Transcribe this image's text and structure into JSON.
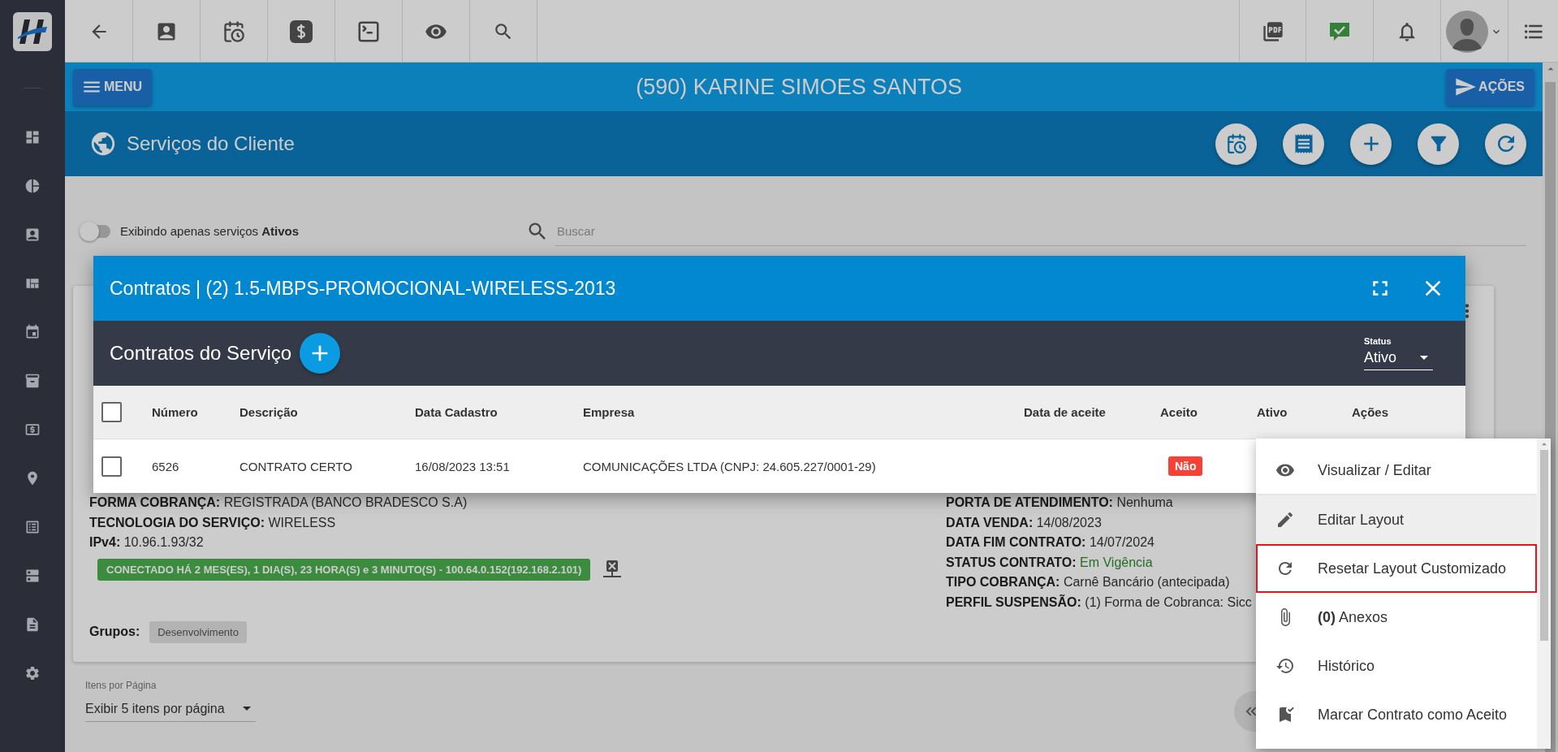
{
  "header": {
    "menu_button": "MENU",
    "client_title": "(590) KARINE SIMOES SANTOS",
    "actions_button": "AÇÕES"
  },
  "section": {
    "title": "Serviços do Cliente"
  },
  "filter": {
    "toggle_label": "Exibindo apenas serviços **Ativos**",
    "toggle_on": false,
    "search_placeholder": "Buscar"
  },
  "service_card": {
    "left_fields": [
      {
        "label": "FORMA COBRANÇA:",
        "value": "REGISTRADA (BANCO BRADESCO S.A)"
      },
      {
        "label": "TECNOLOGIA DO SERVIÇO:",
        "value": "WIRELESS"
      },
      {
        "label": "IPv4:",
        "value": "10.96.1.93/32"
      }
    ],
    "connection": "CONECTADO HÁ 2 MES(ES), 1 DIA(S), 23 HORA(S) e 3 MINUTO(S) - 100.64.0.152(192.168.2.101)",
    "groups_label": "Grupos:",
    "groups": [
      "Desenvolvimento"
    ],
    "right_fields": [
      {
        "label": "PORTA DE ATENDIMENTO:",
        "value": "Nenhuma",
        "kind": "plain"
      },
      {
        "label": "DATA VENDA:",
        "value": "14/08/2023",
        "kind": "plain"
      },
      {
        "label": "DATA FIM CONTRATO:",
        "value": "14/07/2024",
        "kind": "plain"
      },
      {
        "label": "STATUS CONTRATO:",
        "value": "Em Vigência",
        "kind": "status"
      },
      {
        "label": "TIPO COBRANÇA:",
        "value": "Carnê Bancário (antecipada)",
        "kind": "plain"
      },
      {
        "label": "PERFIL SUSPENSÃO:",
        "value": "(1) Forma de Cobranca: Sicc",
        "kind": "plain"
      }
    ]
  },
  "pagination": {
    "label": "Itens por Página",
    "value": "Exibir 5 itens por página"
  },
  "modal": {
    "title": "Contratos | (2) 1.5-MBPS-PROMOCIONAL-WIRELESS-2013",
    "subtitle": "Contratos do Serviço",
    "status_label": "Status",
    "status_value": "Ativo",
    "all_checked": false,
    "columns": [
      "Número",
      "Descrição",
      "Data Cadastro",
      "Empresa",
      "Data de aceite",
      "Aceito",
      "Ativo",
      "Ações"
    ],
    "rows": [
      {
        "checked": false,
        "number": "6526",
        "description": "CONTRATO CERTO",
        "created": "16/08/2023 13:51",
        "company": "COMUNICAÇÕES LTDA (CNPJ: 24.605.227/0001-29)",
        "accepted": "Não"
      }
    ]
  },
  "context_menu": {
    "items": [
      {
        "label": "Visualizar / Editar",
        "hovered": false,
        "focused": false
      },
      {
        "label": "Editar Layout",
        "hovered": true,
        "focused": false
      },
      {
        "label": "Resetar Layout Customizado",
        "hovered": false,
        "focused": true
      },
      {
        "label": "**(0)** Anexos",
        "hovered": false,
        "focused": false
      },
      {
        "label": "Histórico",
        "hovered": false,
        "focused": false
      },
      {
        "label": "Marcar Contrato como Aceito",
        "hovered": false,
        "focused": false
      }
    ]
  }
}
